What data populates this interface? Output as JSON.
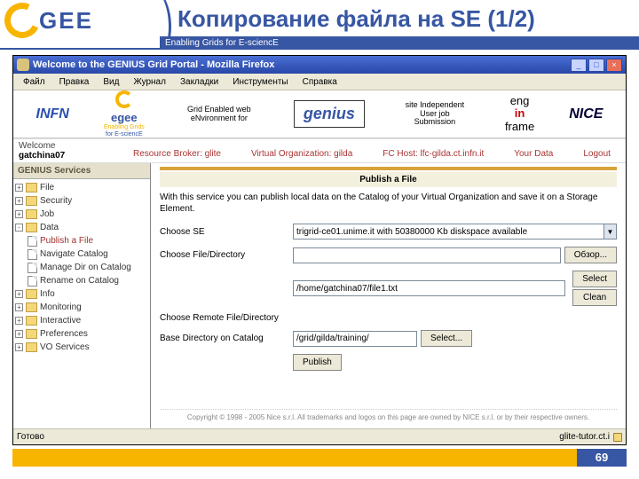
{
  "slide": {
    "title": "Копирование файла на SE (1/2)",
    "subtitle": "Enabling Grids for E-sciencE",
    "logo_text": "GEE",
    "page_number": "69"
  },
  "window": {
    "title": "Welcome to the GENIUS Grid Portal - Mozilla Firefox",
    "min": "_",
    "max": "□",
    "close": "×"
  },
  "menubar": [
    "Файл",
    "Правка",
    "Вид",
    "Журнал",
    "Закладки",
    "Инструменты",
    "Справка"
  ],
  "brands": {
    "infn": "INFN",
    "egee_line1": "egee",
    "egee_line2": "Enabling Grids",
    "egee_line3": "for E-sciencE",
    "grid_env": "Grid Enabled web eNvironment for",
    "genius": "genius",
    "site_indep": "site Independent User job Submission",
    "enginframe": "enginframe",
    "nice": "NICE"
  },
  "welcome": {
    "label": "Welcome",
    "user": "gatchina07"
  },
  "navlinks": {
    "a": "Resource Broker: glite",
    "b": "Virtual Organization: gilda",
    "c": "FC Host: lfc-gilda.ct.infn.it",
    "d": "Your Data",
    "e": "Logout"
  },
  "tree": {
    "title": "GENIUS Services",
    "file": "File",
    "security": "Security",
    "job": "Job",
    "data": "Data",
    "publish": "Publish a File",
    "navigate": "Navigate Catalog",
    "manage": "Manage Dir on Catalog",
    "rename": "Rename on Catalog",
    "info": "Info",
    "monitoring": "Monitoring",
    "interactive": "Interactive",
    "preferences": "Preferences",
    "vo": "VO Services"
  },
  "panel": {
    "title": "Publish a File",
    "desc": "With this service you can publish local data on the Catalog of your Virtual Organization and save it on a Storage Element.",
    "choose_se": "Choose SE",
    "se_value": "trigrid-ce01.unime.it with 50380000 Kb diskspace available",
    "choose_file": "Choose File/Directory",
    "file_value": "/home/gatchina07/file1.txt",
    "browse": "Обзор...",
    "select": "Select",
    "clean": "Clean",
    "choose_remote": "Choose Remote File/Directory",
    "base_dir": "Base Directory on Catalog",
    "base_value": "/grid/gilda/training/",
    "select2": "Select...",
    "publish": "Publish"
  },
  "copyright": "Copyright © 1998 - 2005 Nice s.r.l. All trademarks and logos on this page are owned by NICE s.r.l. or by their respective owners.",
  "status": {
    "left": "Готово",
    "right": "glite-tutor.ct.i"
  }
}
